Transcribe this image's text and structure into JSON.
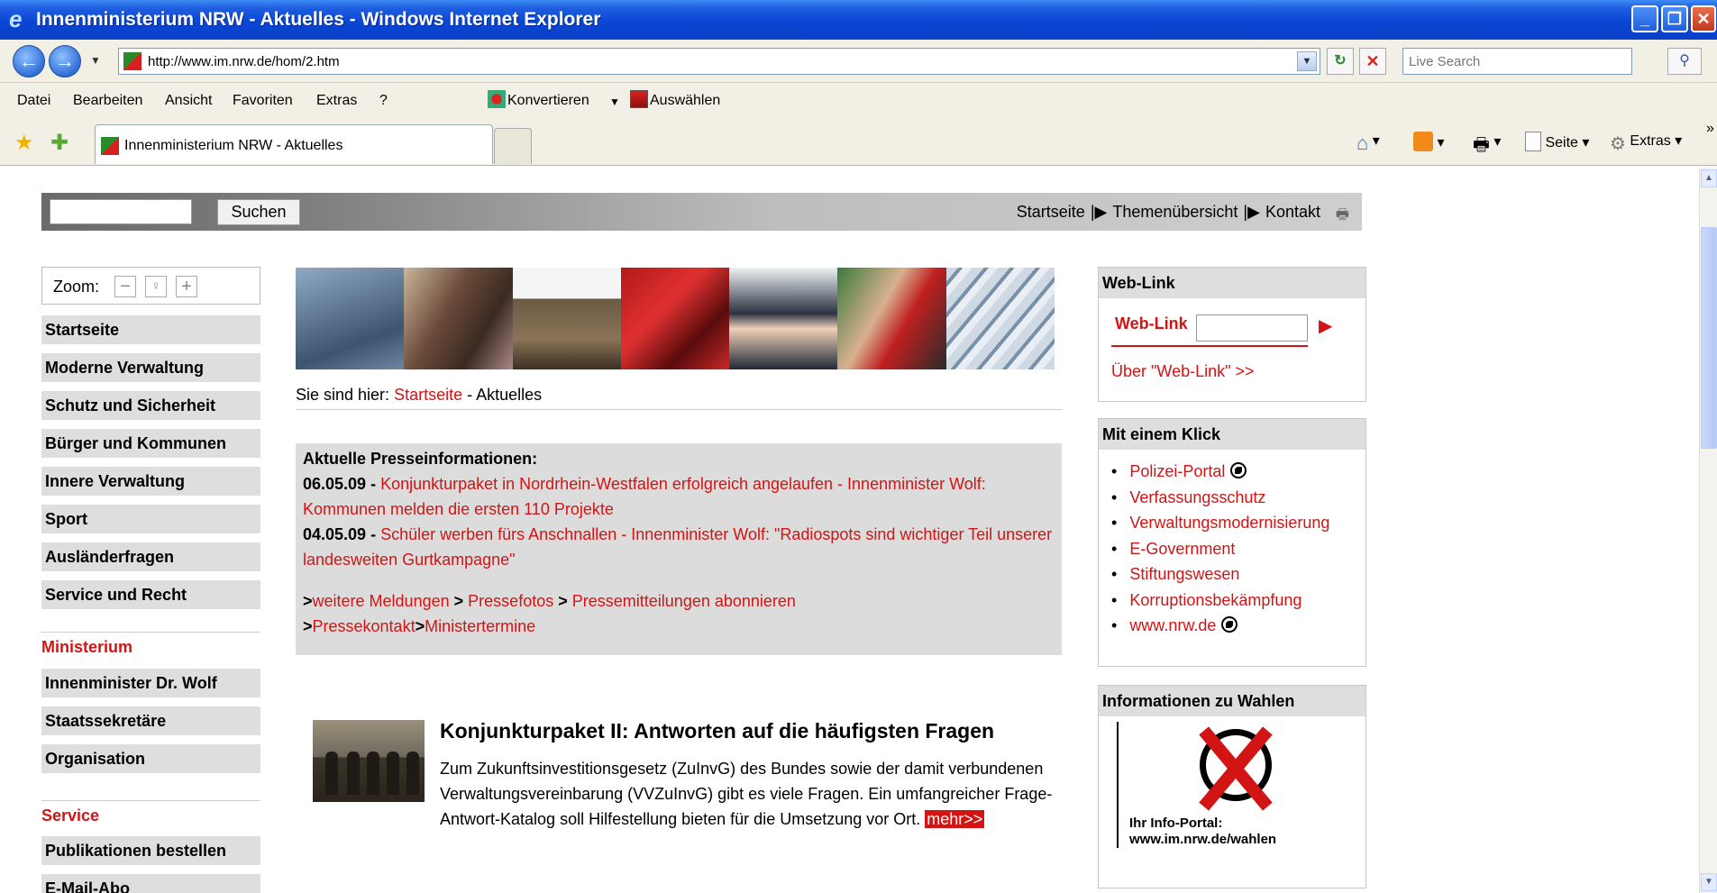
{
  "window": {
    "title": "Innenministerium NRW - Aktuelles - Windows Internet Explorer"
  },
  "addressbar": {
    "url": "http://www.im.nrw.de/hom/2.htm",
    "search_placeholder": "Live Search"
  },
  "menubar": {
    "items": [
      "Datei",
      "Bearbeiten",
      "Ansicht",
      "Favoriten",
      "Extras",
      "?"
    ],
    "convert_label": "Konvertieren",
    "select_label": "Auswählen"
  },
  "tabbar": {
    "tab_title": "Innenministerium NRW - Aktuelles",
    "page_menu": "Seite",
    "tools_menu": "Extras"
  },
  "site": {
    "search_button": "Suchen",
    "top_nav": [
      "Startseite",
      "Themenübersicht",
      "Kontakt"
    ],
    "zoom_label": "Zoom:",
    "nav_main": [
      "Startseite",
      "Moderne Verwaltung",
      "Schutz und Sicherheit",
      "Bürger und Kommunen",
      "Innere Verwaltung",
      "Sport",
      "Ausländerfragen",
      "Service und Recht"
    ],
    "nav_ministerium_head": "Ministerium",
    "nav_ministerium": [
      "Innenminister Dr. Wolf",
      "Staatssekretäre",
      "Organisation"
    ],
    "nav_service_head": "Service",
    "nav_service": [
      "Publikationen bestellen",
      "E-Mail-Abo"
    ],
    "breadcrumb_prefix": "Sie sind hier:",
    "breadcrumb_link": "Startseite",
    "breadcrumb_current": "- Aktuelles",
    "press": {
      "heading": "Aktuelle Presseinformationen:",
      "items": [
        {
          "date": "06.05.09 -",
          "text": "Konjunkturpaket in Nordrhein-Westfalen erfolgreich angelaufen - Innenminister Wolf: Kommunen melden die ersten 110 Projekte"
        },
        {
          "date": "04.05.09 -",
          "text": "Schüler werben fürs Anschnallen - Innenminister Wolf: \"Radiospots sind wichtiger Teil unserer landesweiten Gurtkampagne\""
        }
      ],
      "links_row1": [
        "weitere Meldungen",
        "Pressefotos",
        "Pressemitteilungen abonnieren"
      ],
      "links_row2": [
        "Pressekontakt",
        "Ministertermine"
      ]
    },
    "feature": {
      "title": "Konjunkturpaket II: Antworten auf die häufigsten Fragen",
      "text": "Zum Zukunftsinvestitionsgesetz (ZuInvG) des Bundes sowie der damit verbundenen Verwaltungsvereinbarung (VVZuInvG) gibt es viele Fragen. Ein umfangreicher Frage-Antwort-Katalog soll Hilfestellung bieten für die Umsetzung vor Ort.",
      "more": "mehr>>"
    },
    "weblink_box": {
      "heading": "Web-Link",
      "label": "Web-Link",
      "about": "Über \"Web-Link\" >>"
    },
    "klick_box": {
      "heading": "Mit einem Klick",
      "links": [
        "Polizei-Portal",
        "Verfassungsschutz",
        "Verwaltungsmodernisierung",
        "E-Government",
        "Stiftungswesen",
        "Korruptionsbekämpfung",
        "www.nrw.de"
      ]
    },
    "wahlen_box": {
      "heading": "Informationen zu Wahlen",
      "caption_line1": "Ihr Info-Portal:",
      "caption_line2": "www.im.nrw.de/wahlen"
    }
  },
  "colors": {
    "title_blue": "#0a46d6",
    "link_red": "#d21414",
    "nav_grey": "#dedede"
  }
}
